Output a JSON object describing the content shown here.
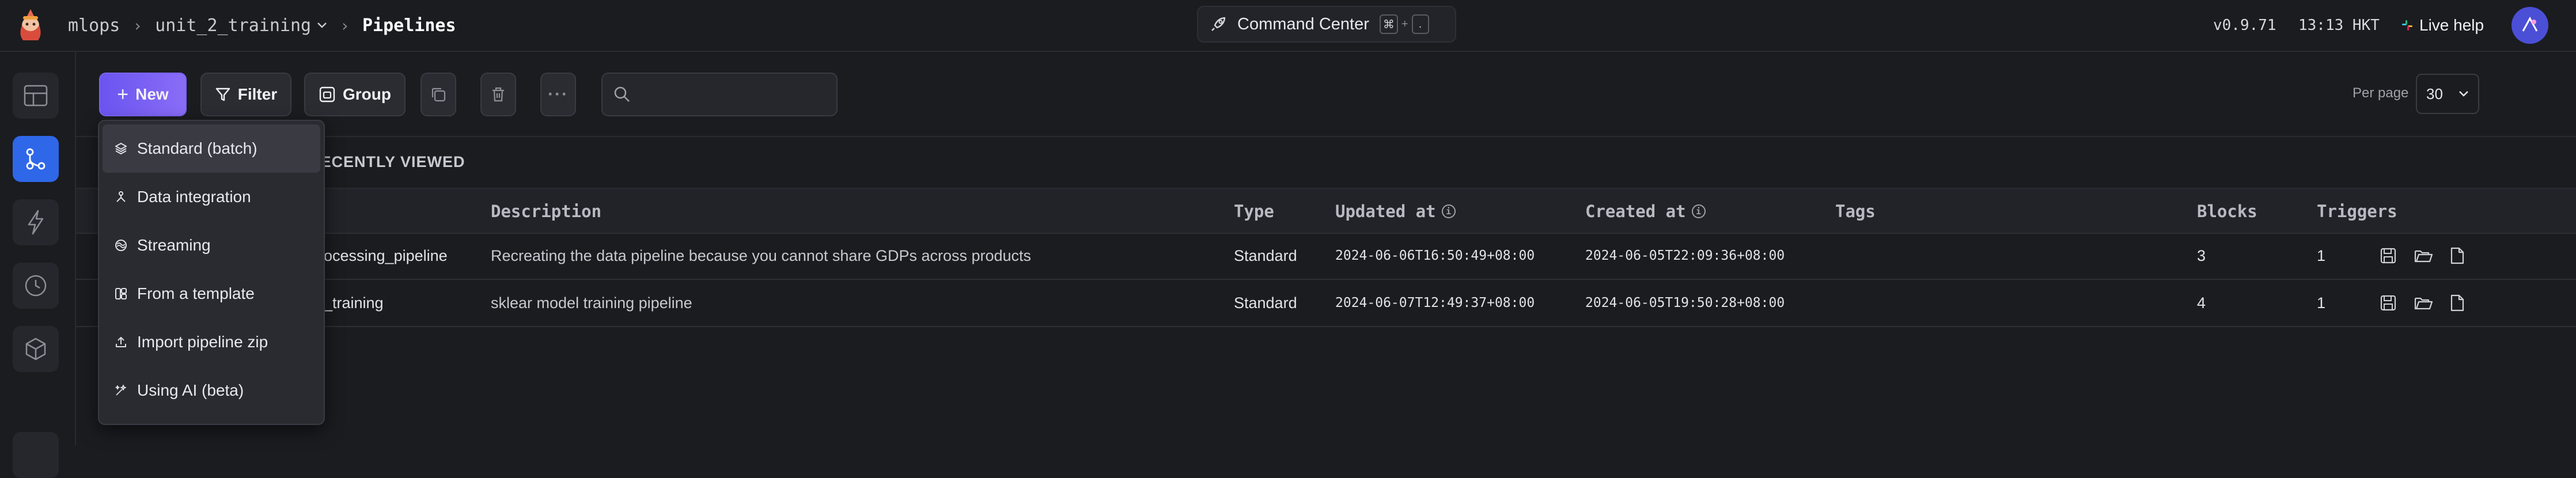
{
  "header": {
    "breadcrumb": [
      "mlops",
      "unit_2_training",
      "Pipelines"
    ],
    "command_center": {
      "label": "Command Center",
      "key1": "⌘",
      "key2": "."
    },
    "version": "v0.9.71",
    "time": "13:13 HKT",
    "live_help": "Live help"
  },
  "toolbar": {
    "new_label": "New",
    "filter_label": "Filter",
    "group_label": "Group",
    "search_placeholder": "",
    "per_page_label": "Per page",
    "per_page_value": "30"
  },
  "section": {
    "title": "RECENTLY VIEWED"
  },
  "table": {
    "columns": [
      "Description",
      "Type",
      "Updated at",
      "Created at",
      "Tags",
      "Blocks",
      "Triggers"
    ],
    "rows": [
      {
        "name": "ocessing_pipeline",
        "description": "Recreating the data pipeline because you cannot share GDPs across products",
        "type": "Standard",
        "updated_at": "2024-06-06T16:50:49+08:00",
        "created_at": "2024-06-05T22:09:36+08:00",
        "tags": "",
        "blocks": "3",
        "triggers": "1"
      },
      {
        "name": "_training",
        "description": "sklear model training pipeline",
        "type": "Standard",
        "updated_at": "2024-06-07T12:49:37+08:00",
        "created_at": "2024-06-05T19:50:28+08:00",
        "tags": "",
        "blocks": "4",
        "triggers": "1"
      }
    ]
  },
  "new_menu": {
    "items": [
      {
        "label": "Standard (batch)",
        "icon": "stack-icon"
      },
      {
        "label": "Data integration",
        "icon": "integration-icon"
      },
      {
        "label": "Streaming",
        "icon": "streaming-icon"
      },
      {
        "label": "From a template",
        "icon": "template-icon"
      },
      {
        "label": "Import pipeline zip",
        "icon": "upload-icon"
      },
      {
        "label": "Using AI (beta)",
        "icon": "sparkle-icon"
      }
    ]
  },
  "colors": {
    "accent": "#6a55f0",
    "nav_active": "#2e67e8",
    "background": "#1b1c20"
  }
}
